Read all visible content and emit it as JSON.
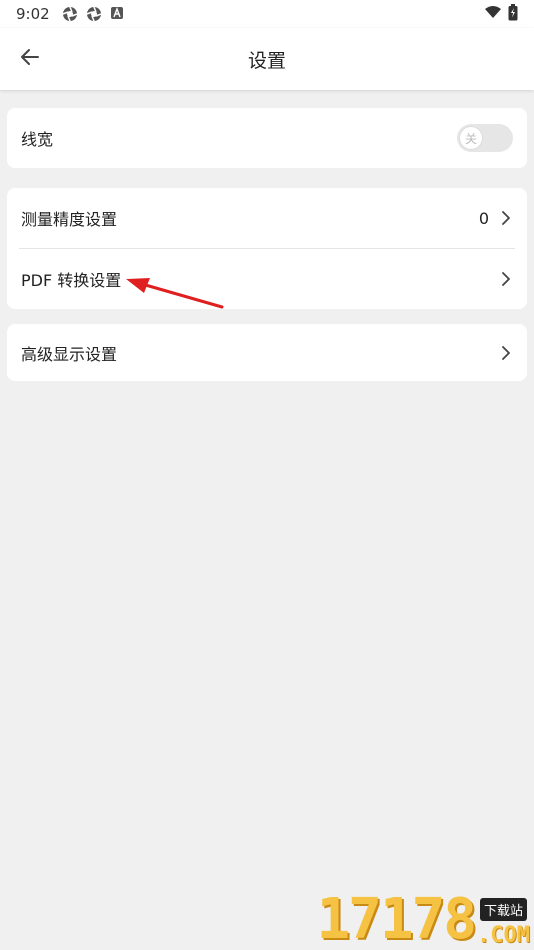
{
  "status_bar": {
    "time": "9:02",
    "icons": [
      "aperture-icon",
      "aperture-icon",
      "a-box-icon"
    ],
    "right_icons": [
      "wifi-icon",
      "battery-icon"
    ]
  },
  "app_bar": {
    "title": "设置",
    "back_icon": "arrow-left-icon"
  },
  "sections": {
    "line_width": {
      "label": "线宽",
      "toggle_text": "关",
      "toggle_on": false
    },
    "measure": {
      "precision_label": "测量精度设置",
      "precision_value": "0",
      "pdf_label": "PDF 转换设置"
    },
    "advanced": {
      "label": "高级显示设置"
    }
  },
  "annotation": {
    "arrow_color": "#e02020"
  },
  "watermark": {
    "digits": "17178",
    "tag": "下载站",
    "domain": ".COM"
  },
  "colors": {
    "background": "#f0f0f0",
    "card": "#ffffff",
    "text": "#222222",
    "divider": "#e4e4e4"
  }
}
